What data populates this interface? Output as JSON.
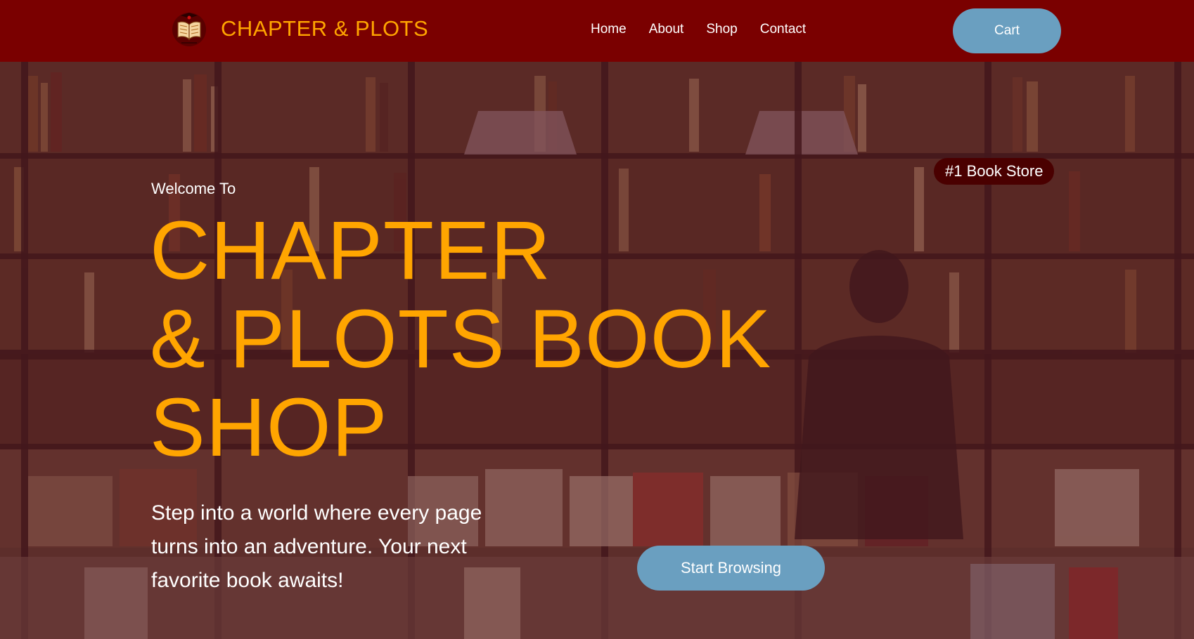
{
  "header": {
    "brand_name": "CHAPTER & PLOTS",
    "nav_links": [
      {
        "label": "Home"
      },
      {
        "label": "About"
      },
      {
        "label": "Shop"
      },
      {
        "label": "Contact"
      }
    ],
    "cart_label": "Cart"
  },
  "hero": {
    "welcome": "Welcome To",
    "title_lines": [
      "CHAPTER",
      "& PLOTS BOOK",
      "SHOP"
    ],
    "description": "Step into a world where every page turns into an adventure. Your next favorite book awaits!",
    "cta_label": "Start Browsing",
    "badge": "#1 Book Store"
  },
  "colors": {
    "header_bg": "#7a0000",
    "accent_orange": "#ffa500",
    "button_blue": "#6a9fc0",
    "badge_bg": "#4a0000"
  },
  "icons": {
    "logo": "open-book-logo-icon"
  }
}
